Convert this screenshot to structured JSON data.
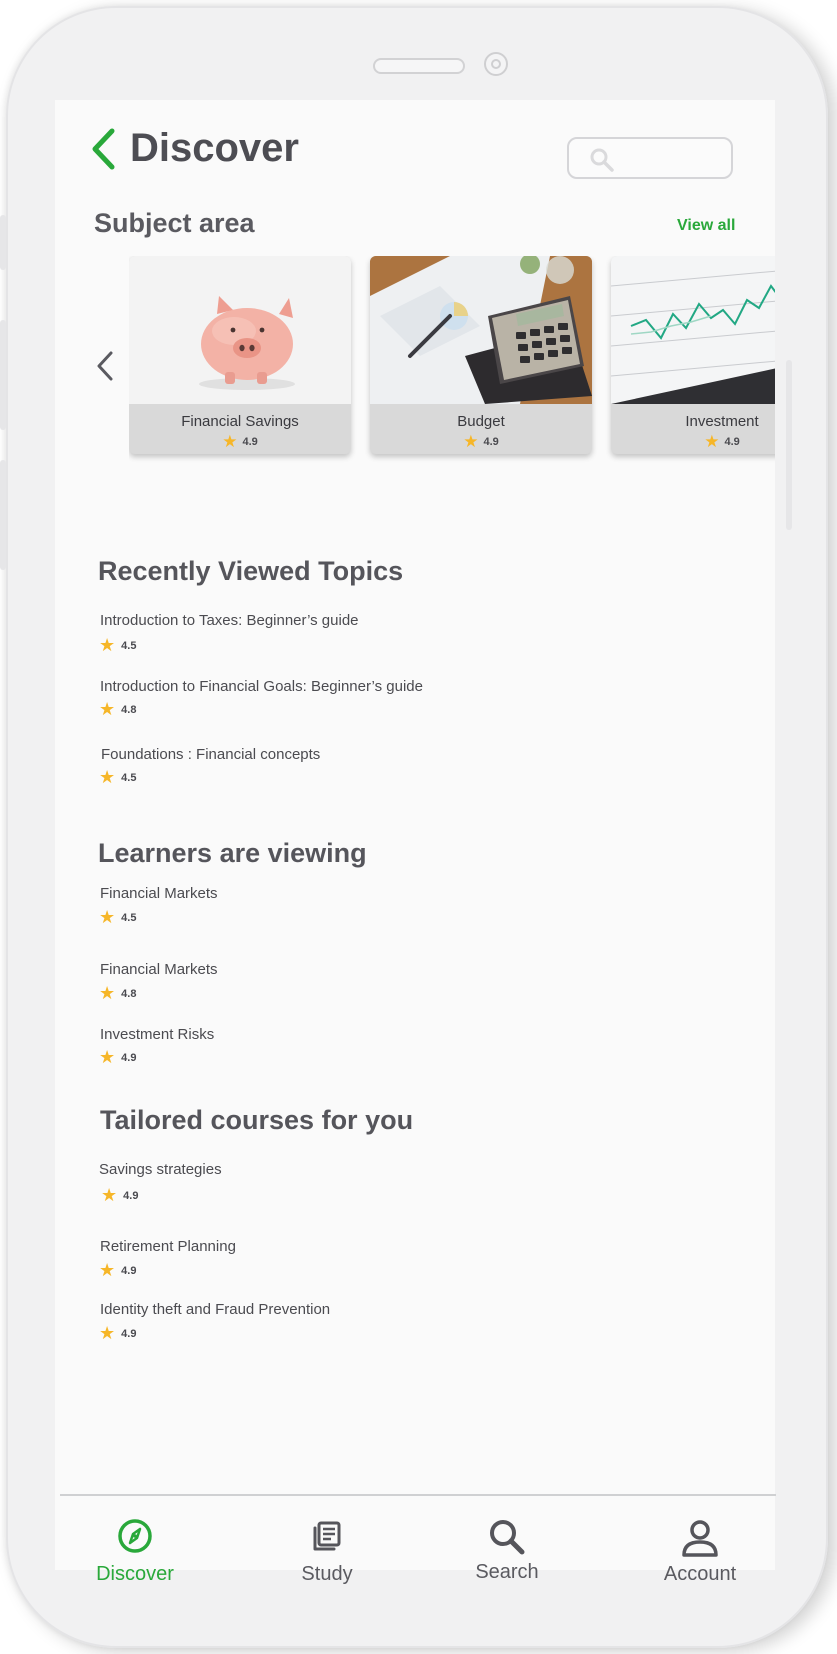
{
  "header": {
    "title": "Discover",
    "search_placeholder": ""
  },
  "subject_area": {
    "title": "Subject area",
    "view_all": "View all",
    "cards": [
      {
        "label": "Financial Savings",
        "rating": "4.9",
        "image": "piggy-bank"
      },
      {
        "label": "Budget",
        "rating": "4.9",
        "image": "calculator-on-desk"
      },
      {
        "label": "Investment",
        "rating": "4.9",
        "image": "line-chart"
      }
    ]
  },
  "recently_viewed": {
    "title": "Recently Viewed Topics",
    "items": [
      {
        "title": "Introduction to Taxes: Beginner’s guide",
        "rating": "4.5"
      },
      {
        "title": "Introduction to Financial Goals: Beginner’s guide",
        "rating": "4.8"
      },
      {
        "title": "Foundations : Financial concepts",
        "rating": "4.5"
      }
    ]
  },
  "learners_viewing": {
    "title": "Learners are viewing",
    "items": [
      {
        "title": "Financial Markets",
        "rating": "4.5"
      },
      {
        "title": "Financial Markets",
        "rating": "4.8"
      },
      {
        "title": "Investment Risks",
        "rating": "4.9"
      }
    ]
  },
  "tailored": {
    "title": "Tailored courses for you",
    "items": [
      {
        "title": "Savings strategies",
        "rating": "4.9"
      },
      {
        "title": "Retirement Planning",
        "rating": "4.9"
      },
      {
        "title": "Identity theft and Fraud Prevention",
        "rating": "4.9"
      }
    ]
  },
  "bottom_nav": {
    "items": [
      {
        "label": "Discover",
        "icon": "compass-icon",
        "active": true
      },
      {
        "label": "Study",
        "icon": "study-icon",
        "active": false
      },
      {
        "label": "Search",
        "icon": "search-icon",
        "active": false
      },
      {
        "label": "Account",
        "icon": "account-icon",
        "active": false
      }
    ]
  },
  "colors": {
    "accent": "#29a83a",
    "star": "#f6b628",
    "text": "#4a4a4f",
    "card_footer": "#d9d9d9"
  }
}
